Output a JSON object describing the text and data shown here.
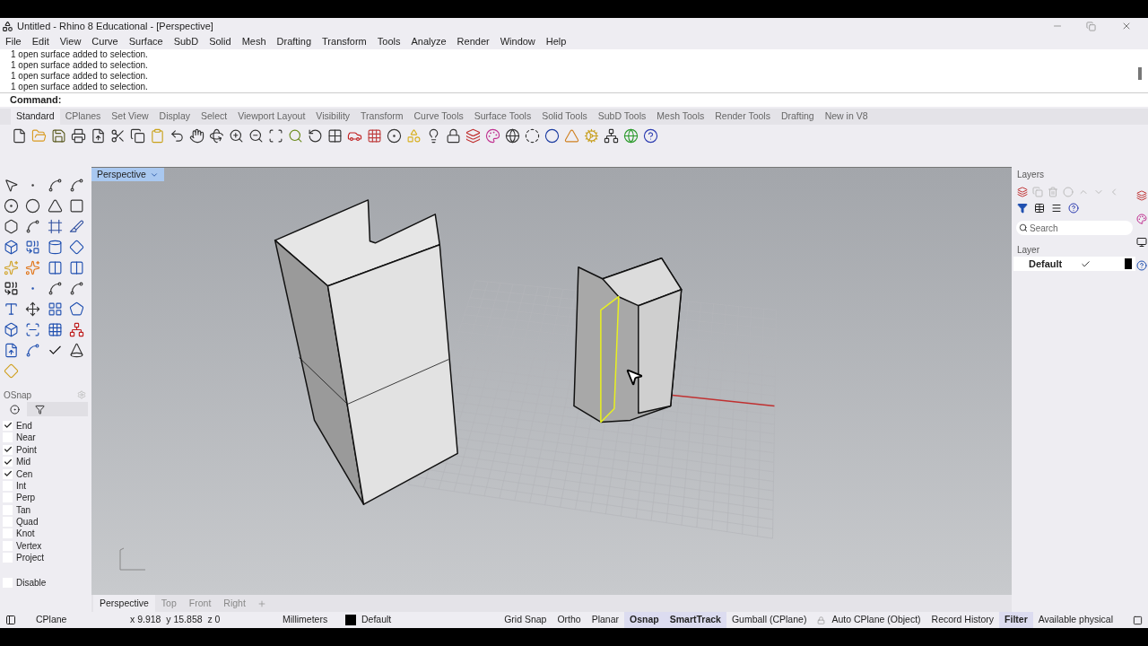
{
  "window": {
    "title": "Untitled - Rhino 8 Educational - [Perspective]"
  },
  "menu": [
    "File",
    "Edit",
    "View",
    "Curve",
    "Surface",
    "SubD",
    "Solid",
    "Mesh",
    "Drafting",
    "Transform",
    "Tools",
    "Analyze",
    "Render",
    "Window",
    "Help"
  ],
  "command_history": [
    "1 open surface added to selection.",
    "1 open surface added to selection.",
    "1 open surface added to selection.",
    "1 open surface added to selection."
  ],
  "command_prompt": "Command:",
  "toolbar_tabs": [
    {
      "label": "Standard",
      "selected": true
    },
    {
      "label": "CPlanes",
      "selected": false
    },
    {
      "label": "Set View",
      "selected": false
    },
    {
      "label": "Display",
      "selected": false
    },
    {
      "label": "Select",
      "selected": false
    },
    {
      "label": "Viewport Layout",
      "selected": false
    },
    {
      "label": "Visibility",
      "selected": false
    },
    {
      "label": "Transform",
      "selected": false
    },
    {
      "label": "Curve Tools",
      "selected": false
    },
    {
      "label": "Surface Tools",
      "selected": false
    },
    {
      "label": "Solid Tools",
      "selected": false
    },
    {
      "label": "SubD Tools",
      "selected": false
    },
    {
      "label": "Mesh Tools",
      "selected": false
    },
    {
      "label": "Render Tools",
      "selected": false
    },
    {
      "label": "Drafting",
      "selected": false
    },
    {
      "label": "New in V8",
      "selected": false
    }
  ],
  "osnap": {
    "title": "OSnap",
    "items": [
      {
        "label": "End",
        "checked": true
      },
      {
        "label": "Near",
        "checked": false
      },
      {
        "label": "Point",
        "checked": true
      },
      {
        "label": "Mid",
        "checked": true
      },
      {
        "label": "Cen",
        "checked": true
      },
      {
        "label": "Int",
        "checked": false
      },
      {
        "label": "Perp",
        "checked": false
      },
      {
        "label": "Tan",
        "checked": false
      },
      {
        "label": "Quad",
        "checked": false
      },
      {
        "label": "Knot",
        "checked": false
      },
      {
        "label": "Vertex",
        "checked": false
      },
      {
        "label": "Project",
        "checked": false
      }
    ],
    "disable": {
      "label": "Disable",
      "checked": false
    }
  },
  "viewport": {
    "title": "Perspective"
  },
  "layers": {
    "title": "Layers",
    "search_placeholder": "Search",
    "column": "Layer",
    "rows": [
      {
        "name": "Default",
        "current": true,
        "color": "#000000"
      }
    ]
  },
  "viewport_tabs": [
    {
      "label": "Perspective",
      "selected": true
    },
    {
      "label": "Top",
      "selected": false
    },
    {
      "label": "Front",
      "selected": false
    },
    {
      "label": "Right",
      "selected": false
    }
  ],
  "status_bar": {
    "cplane": "CPlane",
    "coordinates": "x 9.918  y 15.858  z 0",
    "units": "Millimeters",
    "layer": {
      "name": "Default",
      "color": "#000000"
    },
    "toggles": [
      {
        "label": "Grid Snap",
        "on": false
      },
      {
        "label": "Ortho",
        "on": false
      },
      {
        "label": "Planar",
        "on": false
      },
      {
        "label": "Osnap",
        "on": true
      },
      {
        "label": "SmartTrack",
        "on": true
      },
      {
        "label": "Gumball (CPlane)",
        "on": false
      },
      {
        "label": "Auto CPlane (Object)",
        "on": false,
        "kind": "locked"
      },
      {
        "label": "Record History",
        "on": false
      },
      {
        "label": "Filter",
        "on": true
      }
    ],
    "memory": "Available physical"
  }
}
